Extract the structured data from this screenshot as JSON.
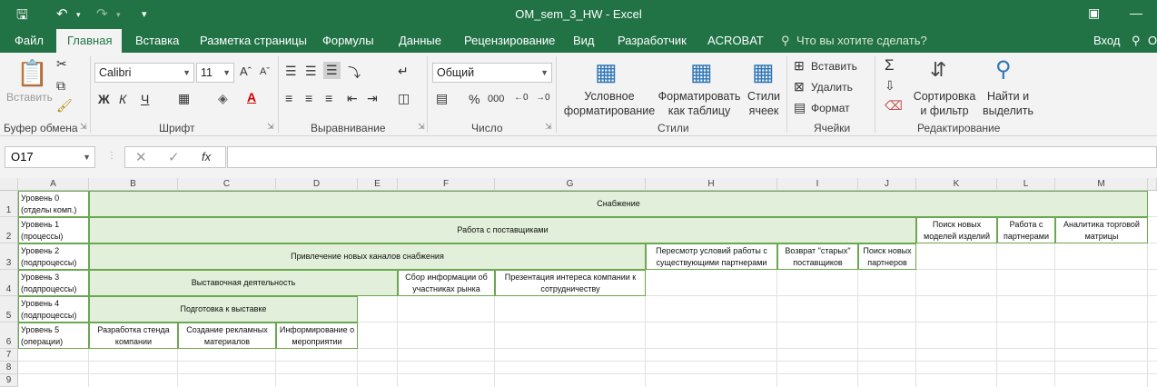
{
  "window": {
    "title": "OM_sem_3_HW  -  Excel",
    "save_icon": "save-icon",
    "undo_icon": "undo-icon",
    "redo_icon": "redo-icon"
  },
  "tabs": [
    {
      "label": "Файл",
      "active": false
    },
    {
      "label": "Главная",
      "active": true
    },
    {
      "label": "Вставка",
      "active": false
    },
    {
      "label": "Разметка страницы",
      "active": false
    },
    {
      "label": "Формулы",
      "active": false
    },
    {
      "label": "Данные",
      "active": false
    },
    {
      "label": "Рецензирование",
      "active": false
    },
    {
      "label": "Вид",
      "active": false
    },
    {
      "label": "Разработчик",
      "active": false
    },
    {
      "label": "ACROBAT",
      "active": false
    }
  ],
  "tellme": "Что вы хотите сделать?",
  "signin": "Вход",
  "share_initial": "О",
  "ribbon": {
    "paste_label": "Вставить",
    "clipboard_label": "Буфер обмена",
    "font_name": "Calibri",
    "font_size": "11",
    "font_label": "Шрифт",
    "bold": "Ж",
    "italic": "К",
    "underline": "Ч",
    "align_label": "Выравнивание",
    "number_format": "Общий",
    "number_label": "Число",
    "percent": "%",
    "thousands": "000",
    "cond_format_1": "Условное",
    "cond_format_2": "форматирование",
    "format_table_1": "Форматировать",
    "format_table_2": "как таблицу",
    "cell_styles_1": "Стили",
    "cell_styles_2": "ячеек",
    "styles_label": "Стили",
    "insert": "Вставить",
    "delete": "Удалить",
    "format": "Формат",
    "cells_label": "Ячейки",
    "sort_1": "Сортировка",
    "sort_2": "и фильтр",
    "find_1": "Найти и",
    "find_2": "выделить",
    "editing_label": "Редактирование"
  },
  "formula_bar": {
    "name_box": "O17",
    "fx": "fx",
    "formula": ""
  },
  "columns": [
    "A",
    "B",
    "C",
    "D",
    "E",
    "F",
    "G",
    "H",
    "I",
    "J",
    "K",
    "L",
    "M"
  ],
  "rows": [
    "1",
    "2",
    "3",
    "4",
    "5",
    "6",
    "7",
    "8",
    "9"
  ],
  "cells": {
    "A1": "Уровень 0 (отделы комп.)",
    "L1": "Снабжение",
    "A2": "Уровень 1 (процессы)",
    "L2": "Работа с поставщиками",
    "K2": "Поиск новых моделей изделий",
    "L2b": "Работа с партнерами",
    "M2": "Аналитика торговой матрицы",
    "A3": "Уровень 2 (подпроцессы)",
    "L3": "Привлечение новых каналов снабжения",
    "H3": "Пересмотр условий работы с существующими партнерами",
    "I3": "Возврат \"старых\" поставщиков",
    "J3": "Поиск новых партнеров",
    "A4": "Уровень 3 (подпроцессы)",
    "L4": "Выставочная деятельность",
    "F4": "Сбор информации об участниках рынка",
    "G4": "Презентация интереса компании к сотрудничеству",
    "A5": "Уровень 4 (подпроцессы)",
    "L5": "Подготовка к выставке",
    "A6": "Уровень 5 (операции)",
    "B6": "Разработка стенда компании",
    "C6": "Создание рекламных материалов",
    "D6": "Информирование о мероприятии"
  }
}
